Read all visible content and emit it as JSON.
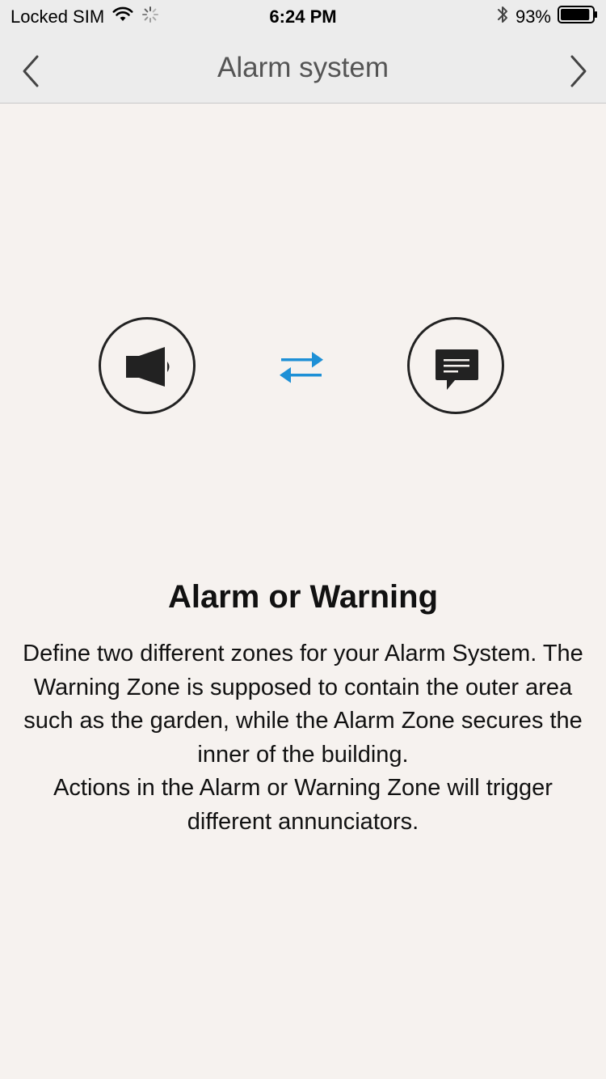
{
  "status_bar": {
    "carrier": "Locked SIM",
    "time": "6:24 PM",
    "battery_percent": "93%",
    "battery_level": 0.93
  },
  "nav": {
    "title": "Alarm system",
    "back_icon": "chevron-left-icon",
    "forward_icon": "chevron-right-icon"
  },
  "illustration": {
    "left_icon": "speaker-icon",
    "middle_icon": "swap-arrows-icon",
    "right_icon": "message-icon",
    "accent_color": "#1e90d6"
  },
  "content": {
    "heading": "Alarm or Warning",
    "paragraph_1": "Define two different zones for your Alarm System. The Warning Zone is supposed to contain the outer area such as the garden, while the Alarm Zone secures the inner of the building.",
    "paragraph_2": "Actions in the Alarm or Warning Zone will trigger different annunciators."
  }
}
